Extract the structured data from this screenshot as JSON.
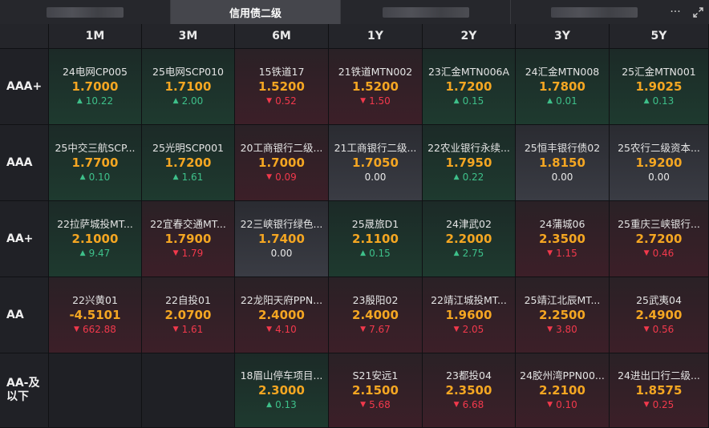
{
  "tabs": [
    {
      "label": "",
      "redacted": true
    },
    {
      "label": "信用债二级",
      "active": true
    },
    {
      "label": "",
      "redacted": true
    },
    {
      "label": "",
      "redacted": true
    }
  ],
  "toolbar": {
    "more_icon": "more-icon",
    "expand_icon": "expand-icon"
  },
  "columns": [
    "1M",
    "3M",
    "6M",
    "1Y",
    "2Y",
    "3Y",
    "5Y"
  ],
  "rows": [
    {
      "label": "AAA+",
      "cells": [
        {
          "name": "24电网CP005",
          "value": "1.7000",
          "change": "10.22",
          "dir": "up"
        },
        {
          "name": "25电网SCP010",
          "value": "1.7100",
          "change": "2.00",
          "dir": "up"
        },
        {
          "name": "15铁道17",
          "value": "1.5200",
          "change": "0.52",
          "dir": "down"
        },
        {
          "name": "21铁道MTN002",
          "value": "1.5200",
          "change": "1.50",
          "dir": "down"
        },
        {
          "name": "23汇金MTN006A",
          "value": "1.7200",
          "change": "0.15",
          "dir": "up"
        },
        {
          "name": "24汇金MTN008",
          "value": "1.7800",
          "change": "0.01",
          "dir": "up"
        },
        {
          "name": "25汇金MTN001",
          "value": "1.9025",
          "change": "0.13",
          "dir": "up"
        }
      ]
    },
    {
      "label": "AAA",
      "cells": [
        {
          "name": "25中交三航SCP...",
          "value": "1.7700",
          "change": "0.10",
          "dir": "up"
        },
        {
          "name": "25光明SCP001",
          "value": "1.7200",
          "change": "1.61",
          "dir": "up"
        },
        {
          "name": "20工商银行二级...",
          "value": "1.7000",
          "change": "0.09",
          "dir": "down"
        },
        {
          "name": "21工商银行二级...",
          "value": "1.7050",
          "change": "0.00",
          "dir": "flat"
        },
        {
          "name": "22农业银行永续...",
          "value": "1.7950",
          "change": "0.22",
          "dir": "up"
        },
        {
          "name": "25恒丰银行债02",
          "value": "1.8150",
          "change": "0.00",
          "dir": "flat"
        },
        {
          "name": "25农行二级资本...",
          "value": "1.9200",
          "change": "0.00",
          "dir": "flat"
        }
      ]
    },
    {
      "label": "AA+",
      "cells": [
        {
          "name": "22拉萨城投MT...",
          "value": "2.1000",
          "change": "9.47",
          "dir": "up"
        },
        {
          "name": "22宜春交通MT...",
          "value": "1.7900",
          "change": "1.79",
          "dir": "down"
        },
        {
          "name": "22三峡银行绿色...",
          "value": "1.7400",
          "change": "0.00",
          "dir": "flat"
        },
        {
          "name": "25晟旅D1",
          "value": "2.1100",
          "change": "0.15",
          "dir": "up"
        },
        {
          "name": "24津武02",
          "value": "2.2000",
          "change": "2.75",
          "dir": "up"
        },
        {
          "name": "24蒲城06",
          "value": "2.3500",
          "change": "1.15",
          "dir": "down"
        },
        {
          "name": "25重庆三峡银行...",
          "value": "2.7200",
          "change": "0.46",
          "dir": "down"
        }
      ]
    },
    {
      "label": "AA",
      "cells": [
        {
          "name": "22兴黄01",
          "value": "-4.5101",
          "change": "662.88",
          "dir": "down"
        },
        {
          "name": "22自投01",
          "value": "2.0700",
          "change": "1.61",
          "dir": "down"
        },
        {
          "name": "22龙阳天府PPN...",
          "value": "2.4000",
          "change": "4.10",
          "dir": "down"
        },
        {
          "name": "23殷阳02",
          "value": "2.4000",
          "change": "7.67",
          "dir": "down"
        },
        {
          "name": "22靖江城投MT...",
          "value": "1.9600",
          "change": "2.05",
          "dir": "down"
        },
        {
          "name": "25靖江北辰MT...",
          "value": "2.2500",
          "change": "3.80",
          "dir": "down"
        },
        {
          "name": "25武夷04",
          "value": "2.4900",
          "change": "0.56",
          "dir": "down"
        }
      ]
    },
    {
      "label": "AA-及\n以下",
      "cells": [
        null,
        null,
        {
          "name": "18眉山停车项目...",
          "value": "2.3000",
          "change": "0.13",
          "dir": "up"
        },
        {
          "name": "S21安远1",
          "value": "2.1500",
          "change": "5.68",
          "dir": "down"
        },
        {
          "name": "23都投04",
          "value": "2.3500",
          "change": "6.68",
          "dir": "down"
        },
        {
          "name": "24胶州湾PPN00...",
          "value": "2.2100",
          "change": "0.10",
          "dir": "down"
        },
        {
          "name": "24进出口行二级...",
          "value": "1.8575",
          "change": "0.25",
          "dir": "down"
        }
      ]
    }
  ],
  "colors": {
    "up": "#3ec08a",
    "down": "#f2394c",
    "value": "#f4a622"
  }
}
